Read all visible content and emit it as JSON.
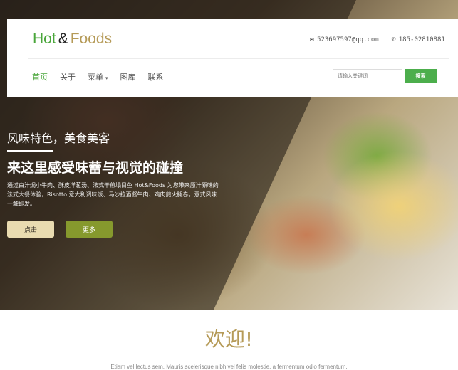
{
  "brand": {
    "part1": "Hot",
    "amp": "&",
    "part2": "Foods"
  },
  "contact": {
    "email_icon": "envelope-icon",
    "email": "523697597@qq.com",
    "phone_icon": "phone-icon",
    "phone": "185-02810881"
  },
  "nav": {
    "items": [
      "首页",
      "关于",
      "菜单",
      "图库",
      "联系"
    ],
    "active": "首页",
    "dropdown_caret": "▾"
  },
  "search": {
    "placeholder": "请输入关键词",
    "button": "搜索"
  },
  "hero": {
    "tagline": "风味特色，美食美客",
    "headline": "来这里感受味蕾与视觉的碰撞",
    "description": "通过白汁焗小牛肉、酥皮洋葱汤、法式干煎塌目鱼 Hot&Foods 为您带来原汁原味的法式大餐体验，Risotto 意大利调味饭、马沙拉酒酱牛肉、鸡肉煎火腿卷，意式风味一触即发。",
    "btn_click": "点击",
    "btn_more": "更多"
  },
  "welcome": {
    "title": "欢迎!",
    "text": "Etiam vel lectus sem. Mauris scelerisque nibh vel felis molestie, a fermentum odio fermentum."
  },
  "colors": {
    "brand_green": "#4aa63b",
    "brand_gold": "#b59a57",
    "search_green": "#4cae4c",
    "more_olive": "#86992d",
    "click_beige": "#e9dbb0"
  }
}
